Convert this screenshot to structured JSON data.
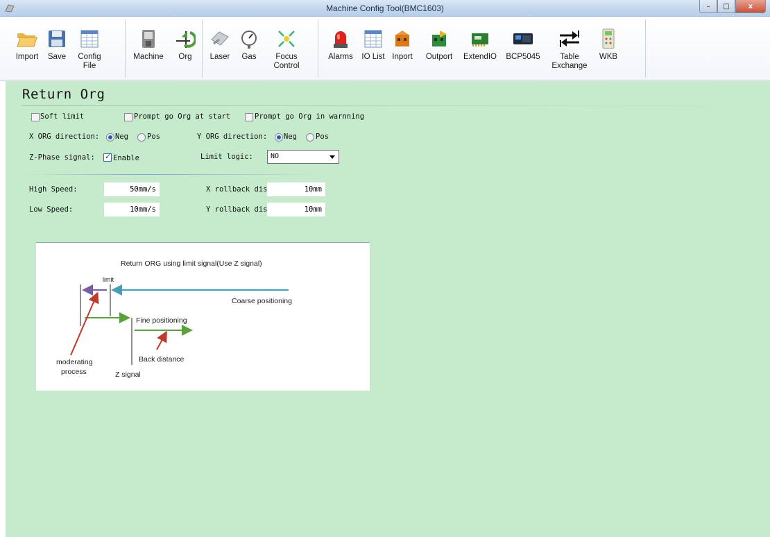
{
  "window": {
    "title": "Machine Config Tool(BMC1603)",
    "controls": {
      "minimize": "–",
      "maximize": "□",
      "close": "x"
    }
  },
  "toolbar": {
    "items": [
      {
        "label": "Import",
        "icon": "folder-open-icon"
      },
      {
        "label": "Save",
        "icon": "floppy-disk-icon"
      },
      {
        "label": "Config File",
        "icon": "table-icon"
      },
      {
        "label": "Machine",
        "icon": "machine-icon"
      },
      {
        "label": "Org",
        "icon": "origin-arrow-icon"
      },
      {
        "label": "Laser",
        "icon": "laser-head-icon"
      },
      {
        "label": "Gas",
        "icon": "pressure-gauge-icon"
      },
      {
        "label": "Focus Control",
        "icon": "focus-arrows-icon"
      },
      {
        "label": "Alarms",
        "icon": "alarm-light-icon"
      },
      {
        "label": "IO List",
        "icon": "io-table-icon"
      },
      {
        "label": "Inport",
        "icon": "inport-connector-icon"
      },
      {
        "label": "Outport",
        "icon": "outport-connector-icon"
      },
      {
        "label": "ExtendIO",
        "icon": "circuit-board-icon"
      },
      {
        "label": "BCP5045",
        "icon": "controller-board-icon"
      },
      {
        "label": "Table Exchange",
        "icon": "exchange-arrows-icon"
      },
      {
        "label": "WKB",
        "icon": "handheld-keypad-icon"
      }
    ]
  },
  "page": {
    "title": "Return Org",
    "options": {
      "soft_limit": {
        "label": "Soft limit",
        "checked": false
      },
      "prompt_start": {
        "label": "Prompt go Org at start",
        "checked": false
      },
      "prompt_warning": {
        "label": "Prompt go Org in warnning",
        "checked": false
      }
    },
    "x_dir": {
      "label": "X ORG direction:",
      "neg": "Neg",
      "pos": "Pos",
      "selected": "Neg"
    },
    "y_dir": {
      "label": "Y ORG direction:",
      "neg": "Neg",
      "pos": "Pos",
      "selected": "Neg"
    },
    "z_phase": {
      "label": "Z-Phase signal:",
      "enable_label": "Enable",
      "checked": true
    },
    "limit_logic": {
      "label": "Limit logic:",
      "value": "NO"
    },
    "high_speed": {
      "label": "High Speed:",
      "value": "50mm/s"
    },
    "low_speed": {
      "label": "Low Speed:",
      "value": "10mm/s"
    },
    "x_rollback": {
      "label": "X rollback dis",
      "value": "10mm"
    },
    "y_rollback": {
      "label": "Y rollback dis",
      "value": "10mm"
    }
  },
  "diagram": {
    "title": "Return ORG using limit signal(Use Z signal)",
    "limit": "limit",
    "coarse": "Coarse positioning",
    "fine": "Fine positioning",
    "back": "Back distance",
    "moderating": "moderating",
    "process": "process",
    "z_signal": "Z signal",
    "colors": {
      "purple": "#7b5aa6",
      "teal": "#4a9bb5",
      "green": "#5aa03c",
      "red": "#c0392b"
    }
  }
}
